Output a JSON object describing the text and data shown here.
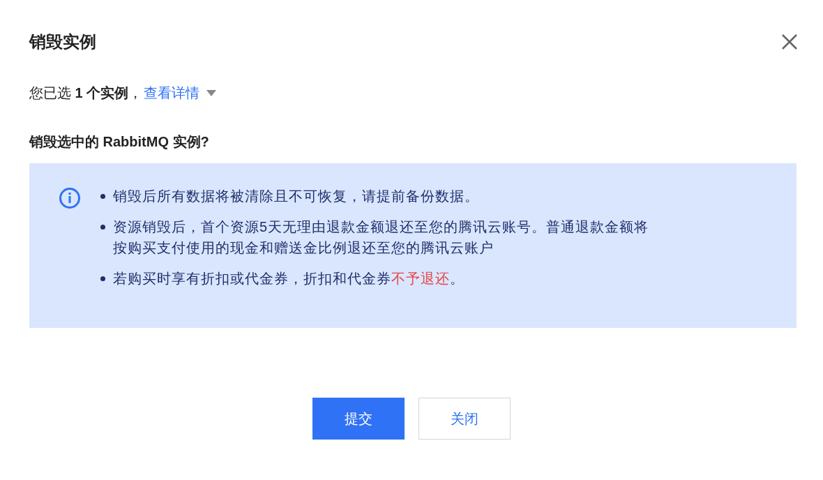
{
  "dialog": {
    "title": "销毁实例"
  },
  "summary": {
    "text": "您已选 **1 个实例**，",
    "link": "查看详情"
  },
  "question": "销毁选中的 RabbitMQ 实例?",
  "notice": {
    "items": [
      {
        "segments": [
          {
            "kind": "normal",
            "text": "销毁后所有数据将被清除且不可恢复，请提前备份数据。"
          }
        ]
      },
      {
        "segments": [
          {
            "kind": "normal",
            "text": "资源销毁后，首个资源5天无理由退款金额退还至您的腾讯云账号。普通退款金额将按购买支付使用的现金和赠送金比例退还至您的腾讯云账户"
          }
        ]
      },
      {
        "segments": [
          {
            "kind": "normal",
            "text": "若购买时享有折扣或代金券，折扣和代金券"
          },
          {
            "kind": "warning",
            "text": "不予退还"
          },
          {
            "kind": "normal",
            "text": "。"
          }
        ]
      }
    ]
  },
  "buttons": [
    {
      "label": "提交",
      "kind": "primary"
    },
    {
      "label": "关闭",
      "kind": "secondary"
    }
  ]
}
